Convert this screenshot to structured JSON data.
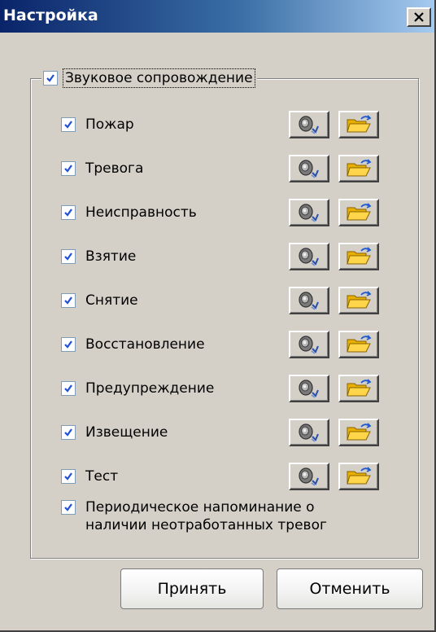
{
  "window": {
    "title": "Настройка"
  },
  "group": {
    "label": "Звуковое сопровождение",
    "checked": true
  },
  "events": [
    {
      "label": "Пожар",
      "checked": true
    },
    {
      "label": "Тревога",
      "checked": true
    },
    {
      "label": "Неисправность",
      "checked": true
    },
    {
      "label": "Взятие",
      "checked": true
    },
    {
      "label": "Снятие",
      "checked": true
    },
    {
      "label": "Восстановление",
      "checked": true
    },
    {
      "label": "Предупреждение",
      "checked": true
    },
    {
      "label": "Извещение",
      "checked": true
    },
    {
      "label": "Тест",
      "checked": true
    }
  ],
  "periodic": {
    "line1": "Периодическое напоминание о",
    "line2": "наличии неотработанных тревог",
    "checked": true
  },
  "buttons": {
    "accept": "Принять",
    "cancel": "Отменить"
  },
  "icons": {
    "play": "speaker-play-icon",
    "open": "open-folder-icon",
    "check": "checkmark-icon",
    "close": "close-x-icon"
  },
  "colors": {
    "title_start": "#0a246a",
    "title_end": "#a6caf0",
    "face": "#d4d0c8",
    "check": "#2150d8"
  }
}
